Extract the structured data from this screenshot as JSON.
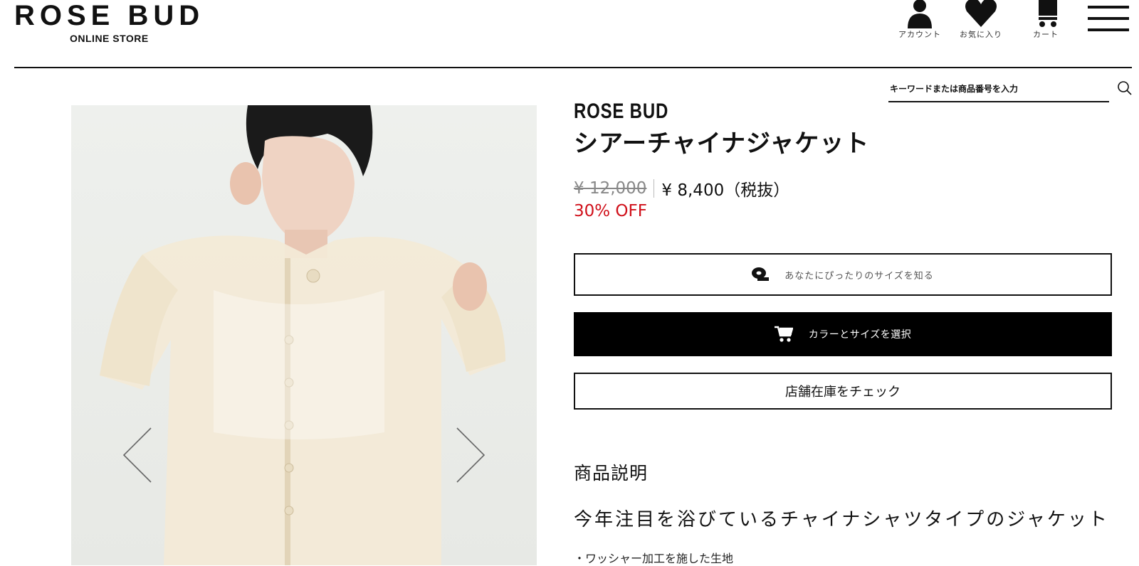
{
  "header": {
    "logo": "ROSE BUD",
    "logo_sub": "ONLINE STORE",
    "icons": [
      {
        "name": "account",
        "label": "アカウント"
      },
      {
        "name": "favorites",
        "label": "お気に入り"
      },
      {
        "name": "cart",
        "label": "カート"
      }
    ]
  },
  "search": {
    "placeholder": "キーワードまたは商品番号を入力"
  },
  "product": {
    "brand": "ROSE BUD",
    "title": "シアーチャイナジャケット",
    "original_price": "¥ 12,000",
    "sale_price": "¥ 8,400（税抜）",
    "discount": "30% OFF"
  },
  "buttons": {
    "size_finder": "あなたにぴったりのサイズを知る",
    "select_color_size": "カラーとサイズを選択",
    "store_stock": "店舗在庫をチェック"
  },
  "description": {
    "heading": "商品説明",
    "lead": "今年注目を浴びているチャイナシャツタイプのジャケット",
    "bullet": "・ワッシャー加工を施した生地"
  },
  "colors": {
    "discount": "#d0101a",
    "primary": "#000000"
  }
}
